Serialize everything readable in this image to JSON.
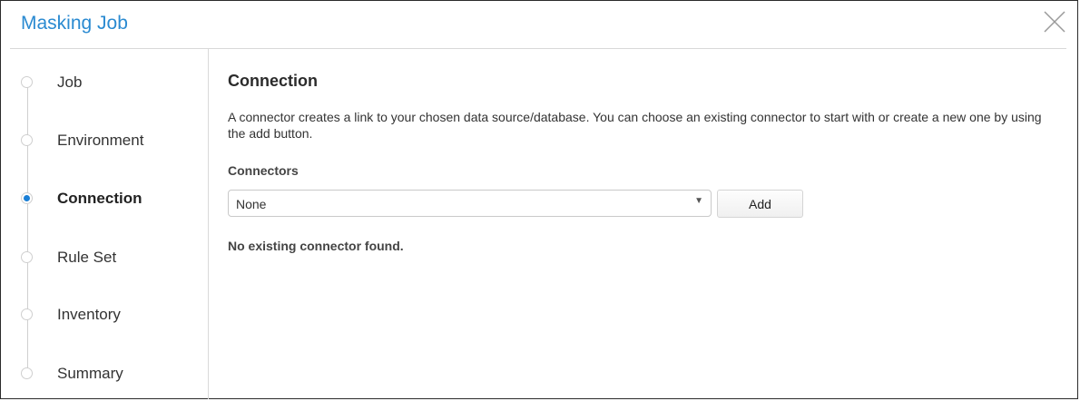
{
  "dialog": {
    "title": "Masking Job",
    "close_icon": "close-icon"
  },
  "steps": [
    {
      "label": "Job",
      "active": false
    },
    {
      "label": "Environment",
      "active": false
    },
    {
      "label": "Connection",
      "active": true
    },
    {
      "label": "Rule Set",
      "active": false
    },
    {
      "label": "Inventory",
      "active": false
    },
    {
      "label": "Summary",
      "active": false
    }
  ],
  "main": {
    "title": "Connection",
    "description": "A connector creates a link to your chosen data source/database. You can choose an existing connector to start with or create a new one by using the add button.",
    "connectors_label": "Connectors",
    "connector_select": {
      "value": "None",
      "icon": "chevron-down-icon"
    },
    "add_label": "Add",
    "empty_message": "No existing connector found."
  },
  "colors": {
    "accent": "#2a8ad1",
    "active_dot": "#1a7fd6"
  }
}
